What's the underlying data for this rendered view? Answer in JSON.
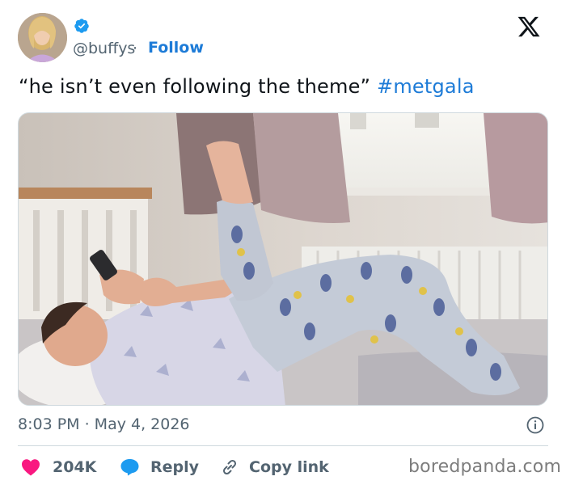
{
  "header": {
    "handle": "@buffys",
    "separator": "·",
    "follow_label": "Follow"
  },
  "tweet": {
    "text": "“he isn’t even following the theme”",
    "hashtag": "#metgala"
  },
  "meta": {
    "timestamp": "8:03 PM · May 4, 2026"
  },
  "actions": {
    "likes": "204K",
    "reply_label": "Reply",
    "copy_label": "Copy link"
  },
  "watermark": "boredpanda.com",
  "colors": {
    "link_blue": "#1d7bd7",
    "like_red": "#f91880",
    "muted": "#536471",
    "verified_blue": "#1d9bf0"
  }
}
